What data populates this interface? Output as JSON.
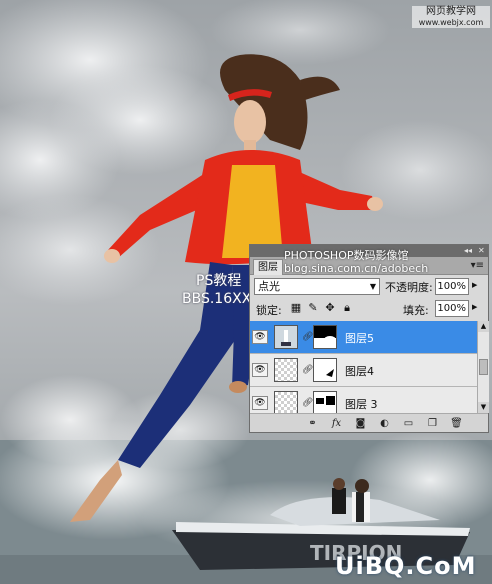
{
  "watermarks": {
    "top_right_line1": "网页教学网",
    "top_right_line2": "www.webjx.com",
    "panel_overlay_title": "PHOTOSHOP数码影像馆",
    "panel_overlay_url": "blog.sina.com.cn/adobech",
    "ps_line1": "PS教程",
    "ps_line2": "BBS.16XX8.COM",
    "brand_bottom": "UiBQ.CoM",
    "boat_text": "TIRPION"
  },
  "layers_panel": {
    "tab_label": "图层",
    "blend_mode": "点光",
    "opacity_label": "不透明度:",
    "opacity_value": "100%",
    "lock_label": "锁定:",
    "fill_label": "填充:",
    "fill_value": "100%",
    "layers": [
      {
        "name": "图层5",
        "selected": true
      },
      {
        "name": "图层4",
        "selected": false
      },
      {
        "name": "图层 3",
        "selected": false
      }
    ],
    "icons": [
      "eye-icon",
      "chain-icon",
      "fx-icon",
      "mask-icon",
      "adjustment-icon",
      "group-icon",
      "new-layer-icon",
      "trash-icon"
    ]
  },
  "colors": {
    "selection": "#3a8be6",
    "jacket": "#e32a1a",
    "top": "#f2b320",
    "leggings": "#1c2f78"
  }
}
